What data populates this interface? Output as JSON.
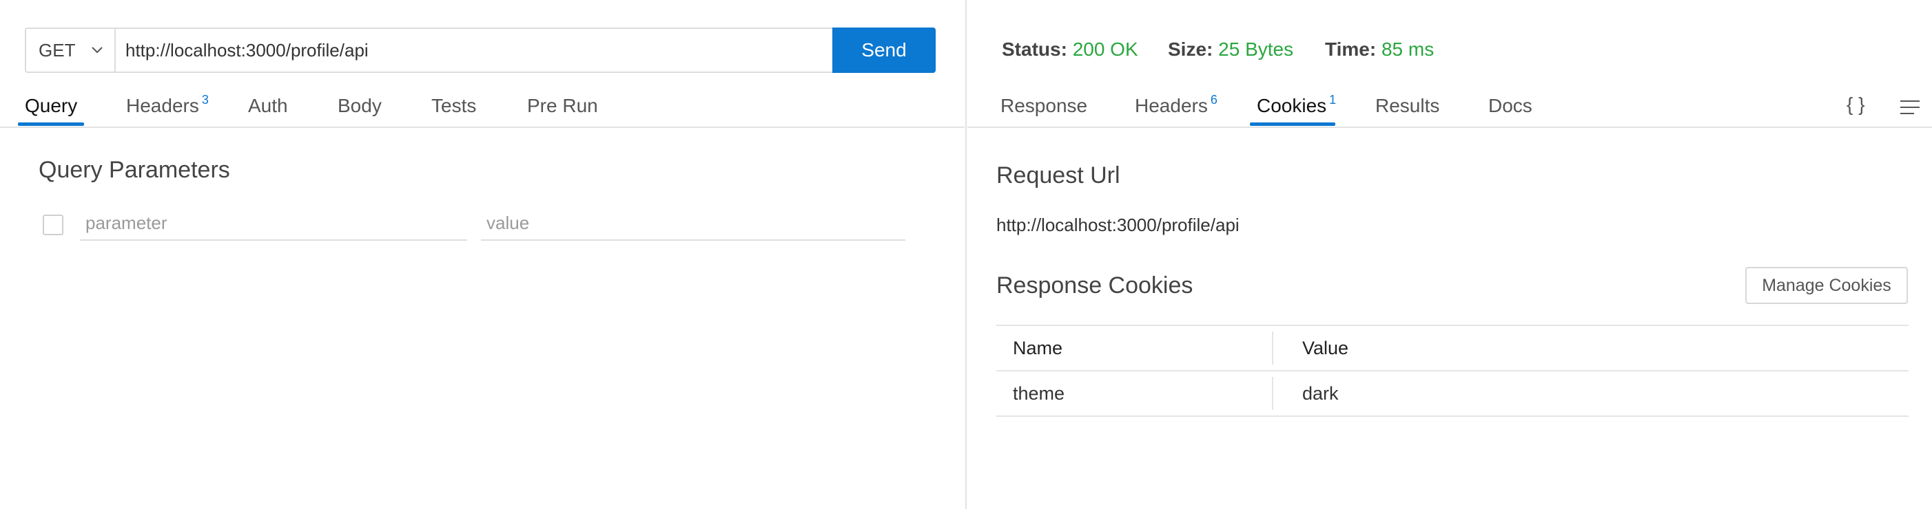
{
  "request": {
    "method": "GET",
    "url": "http://localhost:3000/profile/api",
    "send_label": "Send"
  },
  "request_tabs": [
    {
      "label": "Query",
      "badge": ""
    },
    {
      "label": "Headers",
      "badge": "3"
    },
    {
      "label": "Auth",
      "badge": ""
    },
    {
      "label": "Body",
      "badge": ""
    },
    {
      "label": "Tests",
      "badge": ""
    },
    {
      "label": "Pre Run",
      "badge": ""
    }
  ],
  "query": {
    "title": "Query Parameters",
    "param_placeholder": "parameter",
    "value_placeholder": "value"
  },
  "status": {
    "status_label": "Status:",
    "status_value": "200 OK",
    "size_label": "Size:",
    "size_value": "25 Bytes",
    "time_label": "Time:",
    "time_value": "85 ms",
    "ok_color": "#2aa73f"
  },
  "response_tabs": [
    {
      "label": "Response",
      "badge": ""
    },
    {
      "label": "Headers",
      "badge": "6"
    },
    {
      "label": "Cookies",
      "badge": "1"
    },
    {
      "label": "Results",
      "badge": ""
    },
    {
      "label": "Docs",
      "badge": ""
    }
  ],
  "toolbar": {
    "json_icon": "{ }",
    "menu_icon": "hamburger-icon"
  },
  "cookies": {
    "request_url_title": "Request Url",
    "request_url": "http://localhost:3000/profile/api",
    "response_cookies_title": "Response Cookies",
    "manage_label": "Manage Cookies",
    "columns": [
      "Name",
      "Value"
    ],
    "rows": [
      {
        "name": "theme",
        "value": "dark"
      }
    ]
  },
  "accent_color": "#0b78d1"
}
